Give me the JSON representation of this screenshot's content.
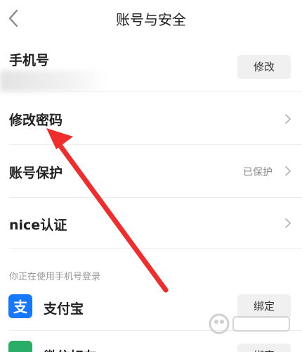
{
  "header": {
    "title": "账号与安全"
  },
  "phone": {
    "label": "手机号",
    "button": "修改"
  },
  "rows": [
    {
      "label": "修改密码",
      "status": ""
    },
    {
      "label": "账号保护",
      "status": "已保护"
    },
    {
      "label": "nice认证",
      "status": ""
    }
  ],
  "login_section": {
    "caption": "你正在使用手机号登录",
    "items": [
      {
        "label": "支付宝",
        "button": "绑定"
      },
      {
        "label": "微信好友",
        "button": "绑定"
      }
    ]
  },
  "colors": {
    "alipay": "#1677ff",
    "wechat": "#2aae67",
    "arrow": "#ef2d2d"
  }
}
